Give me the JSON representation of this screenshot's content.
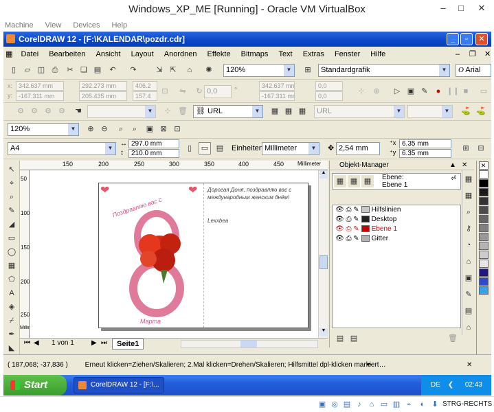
{
  "host": {
    "title": "Windows_XP_ME [Running] - Oracle VM VirtualBox",
    "menu": [
      "Machine",
      "View",
      "Devices",
      "Help"
    ],
    "status_text": "STRG-RECHTS"
  },
  "app": {
    "title": "CorelDRAW 12 - [F:\\KALENDAR\\pozdr.cdr]",
    "menu": [
      "Datei",
      "Bearbeiten",
      "Ansicht",
      "Layout",
      "Anordnen",
      "Effekte",
      "Bitmaps",
      "Text",
      "Extras",
      "Fenster",
      "Hilfe"
    ],
    "zoom_std": "120%",
    "style_field": "Standardgrafik",
    "font_field": "Arial",
    "coords": {
      "x": "342.637 mm",
      "y": "-167.311 mm",
      "w": "292.273 mm",
      "h": "205.435 mm",
      "sx": "406.2",
      "sy": "157.4",
      "angle": "0,0",
      "x2": "342.637 mm",
      "y2": "-167.311 mm",
      "pct": "0,0",
      "pct2": "0,0"
    },
    "url_label": "URL",
    "url_field": "URL",
    "zoom2": "120%",
    "paper": "A4",
    "paper_w": "297.0 mm",
    "paper_h": "210.0 mm",
    "units_label": "Einheiten:",
    "units_value": "Millimeter",
    "nudge": "2,54 mm",
    "dup_x": "6.35 mm",
    "dup_y": "6.35 mm",
    "ruler_top": [
      "150",
      "200",
      "250",
      "300",
      "350",
      "400",
      "450",
      "Millimeter"
    ],
    "ruler_left": [
      "50",
      "100",
      "150",
      "200",
      "250",
      "Millimeter"
    ],
    "page_nav": "1 von 1",
    "page_tab": "Seite1",
    "card": {
      "greeting_left": "Поздравляю вас с",
      "signature": "Марта",
      "text_right": "Дорогая Доня, поздравляю вас с международным женским днём!",
      "name_right": "Lexxbea"
    },
    "objmgr": {
      "title": "Objekt-Manager",
      "ebene_label": "Ebene:",
      "ebene_value": "Ebene 1",
      "layers": [
        {
          "name": "Hilfslinien",
          "color": "#c8c8c8",
          "active": false
        },
        {
          "name": "Desktop",
          "color": "#222222",
          "active": false
        },
        {
          "name": "Ebene 1",
          "color": "#cc0000",
          "active": true
        },
        {
          "name": "Gitter",
          "color": "#b0b0b0",
          "active": false
        }
      ]
    },
    "status_coords": "( 187,068; -37,836 )",
    "status_hint": "Erneut klicken=Ziehen/Skalieren; 2.Mal klicken=Drehen/Skalieren; Hilfsmittel dpl-klicken markiert…",
    "palette": [
      "#ffffff",
      "#000000",
      "#1a1a1a",
      "#333333",
      "#4d4d4d",
      "#666666",
      "#808080",
      "#999999",
      "#b3b3b3",
      "#cccccc",
      "#e6e6e6",
      "#1f1a80",
      "#2f4ad0",
      "#3aa0e8"
    ]
  },
  "taskbar": {
    "start": "Start",
    "item": "CorelDRAW 12 - [F:\\...",
    "lang": "DE",
    "time": "02:43"
  }
}
